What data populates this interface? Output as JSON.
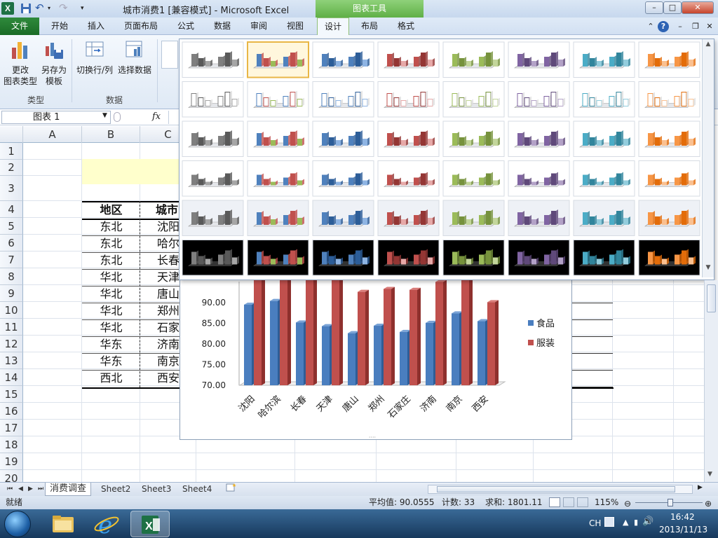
{
  "window": {
    "title": "城市消费1  [兼容模式] - Microsoft Excel",
    "context_tab": "图表工具",
    "app_icon": "X"
  },
  "tabs": [
    "文件",
    "开始",
    "插入",
    "页面布局",
    "公式",
    "数据",
    "审阅",
    "视图",
    "设计",
    "布局",
    "格式"
  ],
  "ribbon": {
    "change_type": [
      "更改",
      "图表类型"
    ],
    "save_template": [
      "另存为",
      "模板"
    ],
    "switch_row_col": "切换行/列",
    "select_data": "选择数据",
    "group_type": "类型",
    "group_data": "数据"
  },
  "formula_bar": {
    "name_box": "图表 1",
    "fx": "fx"
  },
  "grid": {
    "columns": [
      "A",
      "B",
      "C"
    ],
    "rows": [
      "1",
      "2",
      "3",
      "4",
      "5",
      "6",
      "7",
      "8",
      "9",
      "10",
      "11",
      "12",
      "13",
      "14",
      "15",
      "16",
      "17",
      "18",
      "19",
      "20"
    ],
    "table_header": [
      "地区",
      "城市"
    ],
    "table_rows": [
      [
        "东北",
        "沈阳"
      ],
      [
        "东北",
        "哈尔滨"
      ],
      [
        "东北",
        "长春"
      ],
      [
        "华北",
        "天津"
      ],
      [
        "华北",
        "唐山"
      ],
      [
        "华北",
        "郑州"
      ],
      [
        "华北",
        "石家庄"
      ],
      [
        "华东",
        "济南"
      ],
      [
        "华东",
        "南京"
      ],
      [
        "西北",
        "西安"
      ]
    ],
    "c_visible": [
      "沈阳",
      "哈尔",
      "长春",
      "天津",
      "唐山",
      "郑州",
      "石家",
      "济南",
      "南京",
      "西安"
    ]
  },
  "chart_data": {
    "type": "bar",
    "categories": [
      "沈阳",
      "哈尔滨",
      "长春",
      "天津",
      "唐山",
      "郑州",
      "石家庄",
      "济南",
      "南京",
      "西安"
    ],
    "series": [
      {
        "name": "食品",
        "values": [
          89.5,
          90.4,
          85.2,
          84.3,
          82.6,
          84.4,
          82.9,
          85.1,
          87.4,
          85.5
        ],
        "color": "#4a7ebf"
      },
      {
        "name": "服装",
        "values": [
          97.5,
          96.0,
          97.0,
          95.5,
          92.6,
          93.3,
          93.1,
          95.0,
          96.2,
          90.1
        ],
        "color": "#c0504d"
      }
    ],
    "y_ticks": [
      "90.00",
      "85.00",
      "80.00",
      "75.00",
      "70.00"
    ],
    "ylim": [
      70,
      92.5
    ],
    "legend_position": "right",
    "style": "3d-column"
  },
  "gallery": {
    "rows": 6,
    "cols": 8,
    "selected": [
      0,
      1
    ],
    "palettes": [
      [
        "#7f7f7f",
        "#595959",
        "#a6a6a6"
      ],
      [
        "#4f81bd",
        "#c0504d",
        "#9bbb59"
      ],
      [
        "#4f81bd",
        "#2c5d98",
        "#8eb4e3"
      ],
      [
        "#c0504d",
        "#943634",
        "#e6a9a8"
      ],
      [
        "#9bbb59",
        "#76923c",
        "#c3d69b"
      ],
      [
        "#8064a2",
        "#5f497a",
        "#b3a2c7"
      ],
      [
        "#4bacc6",
        "#31859c",
        "#93cddd"
      ],
      [
        "#f79646",
        "#e36c09",
        "#fac090"
      ]
    ]
  },
  "sheets": [
    "消费调查",
    "Sheet2",
    "Sheet3",
    "Sheet4"
  ],
  "status": {
    "ready": "就绪",
    "average": "平均值: 90.0555",
    "count": "计数: 33",
    "sum": "求和: 1801.11",
    "zoom": "115%"
  },
  "taskbar": {
    "lang": "CH",
    "time": "16:42",
    "date": "2013/11/13"
  }
}
